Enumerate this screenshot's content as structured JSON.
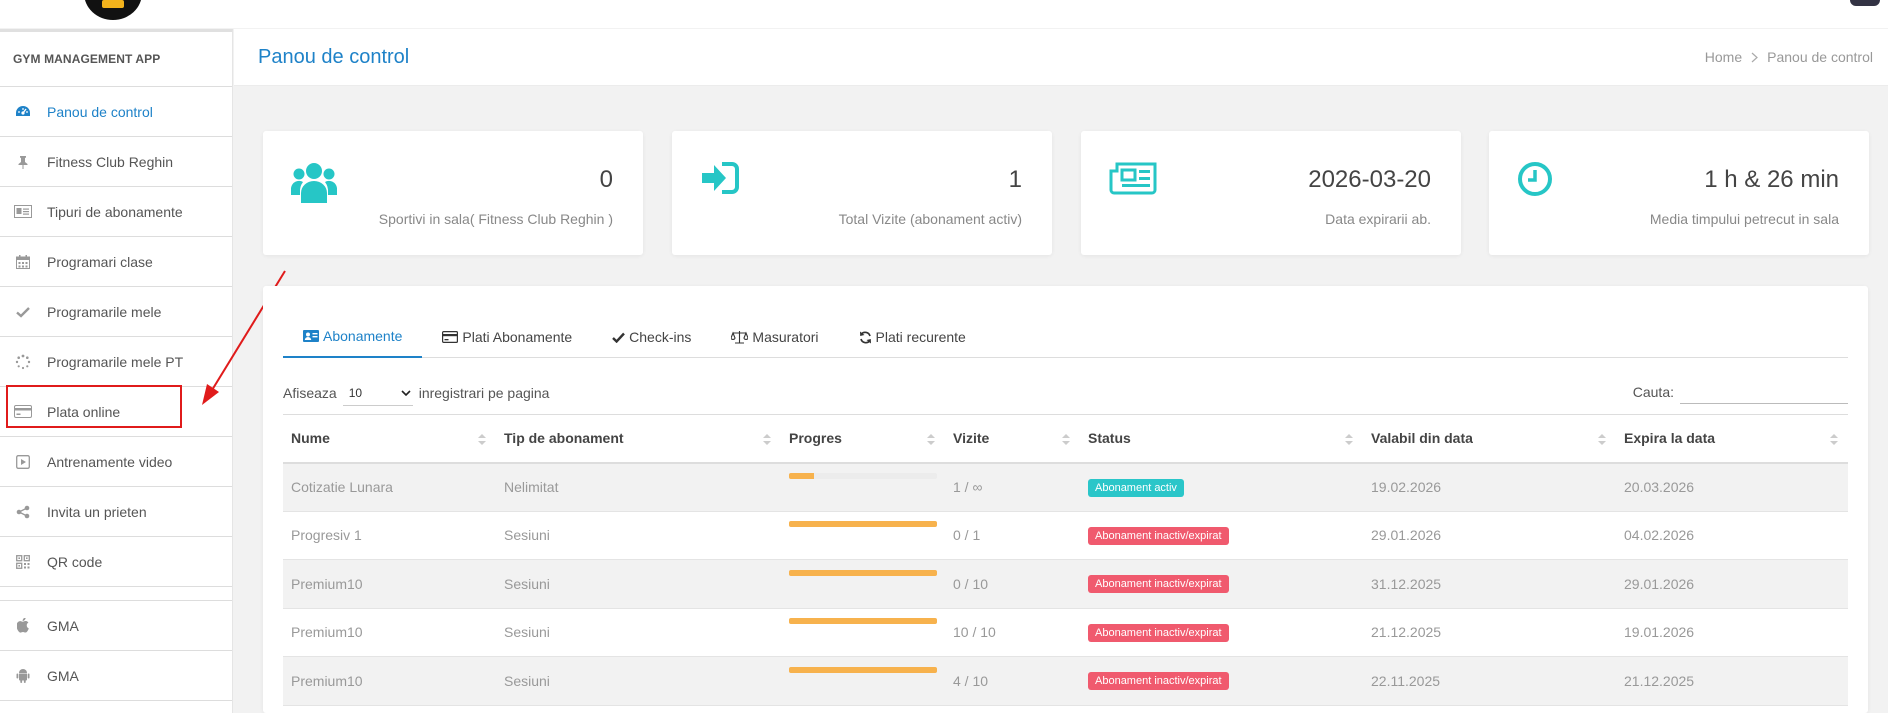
{
  "app": {
    "name": "GYM MANAGEMENT APP"
  },
  "sidebar": {
    "items": [
      {
        "label": "Panou de control",
        "icon": "dashboard-icon",
        "active": true
      },
      {
        "label": "Fitness Club Reghin",
        "icon": "pin-icon"
      },
      {
        "label": "Tipuri de abonamente",
        "icon": "card-icon"
      },
      {
        "label": "Programari clase",
        "icon": "calendar-icon"
      },
      {
        "label": "Programarile mele",
        "icon": "check-icon"
      },
      {
        "label": "Programarile mele PT",
        "icon": "spinner-icon"
      },
      {
        "label": "Plata online",
        "icon": "credit-card-icon"
      },
      {
        "label": "Antrenamente video",
        "icon": "play-icon"
      },
      {
        "label": "Invita un prieten",
        "icon": "share-icon"
      },
      {
        "label": "QR code",
        "icon": "qrcode-icon"
      }
    ],
    "apps": [
      {
        "label": "GMA",
        "icon": "apple-icon"
      },
      {
        "label": "GMA",
        "icon": "android-icon"
      }
    ]
  },
  "header": {
    "title": "Panou de control",
    "breadcrumb": [
      "Home",
      "Panou de control"
    ]
  },
  "stats": [
    {
      "value": "0",
      "label": "Sportivi in sala( Fitness Club Reghin )",
      "icon": "users-icon"
    },
    {
      "value": "1",
      "label": "Total Vizite (abonament activ)",
      "icon": "sign-in-icon"
    },
    {
      "value": "2026-03-20",
      "label": "Data expirarii ab.",
      "icon": "newspaper-icon"
    },
    {
      "value": "1 h & 26 min",
      "label": "Media timpului petrecut in sala",
      "icon": "clock-icon"
    }
  ],
  "tabs": [
    {
      "label": "Abonamente",
      "icon": "id-card-icon",
      "active": true
    },
    {
      "label": "Plati Abonamente",
      "icon": "credit-card-icon"
    },
    {
      "label": "Check-ins",
      "icon": "check-icon"
    },
    {
      "label": "Masuratori",
      "icon": "balance-scale-icon"
    },
    {
      "label": "Plati recurente",
      "icon": "refresh-icon"
    }
  ],
  "table_controls": {
    "show_label": "Afiseaza",
    "page_size": "10",
    "records_label": "inregistrari pe pagina",
    "search_label": "Cauta:",
    "search_value": ""
  },
  "table": {
    "columns": [
      "Nume",
      "Tip de abonament",
      "Progres",
      "Vizite",
      "Status",
      "Valabil din data",
      "Expira la data"
    ],
    "rows": [
      {
        "name": "Cotizatie Lunara",
        "type": "Nelimitat",
        "progress": 0.17,
        "visits": "1 / ∞",
        "status": "Abonament activ",
        "status_kind": "active",
        "from": "19.02.2026",
        "to": "20.03.2026"
      },
      {
        "name": "Progresiv 1",
        "type": "Sesiuni",
        "progress": 1.0,
        "visits": "0 / 1",
        "status": "Abonament inactiv/expirat",
        "status_kind": "expired",
        "from": "29.01.2026",
        "to": "04.02.2026"
      },
      {
        "name": "Premium10",
        "type": "Sesiuni",
        "progress": 1.0,
        "visits": "0 / 10",
        "status": "Abonament inactiv/expirat",
        "status_kind": "expired",
        "from": "31.12.2025",
        "to": "29.01.2026"
      },
      {
        "name": "Premium10",
        "type": "Sesiuni",
        "progress": 1.0,
        "visits": "10 / 10",
        "status": "Abonament inactiv/expirat",
        "status_kind": "expired",
        "from": "21.12.2025",
        "to": "19.01.2026"
      },
      {
        "name": "Premium10",
        "type": "Sesiuni",
        "progress": 1.0,
        "visits": "4 / 10",
        "status": "Abonament inactiv/expirat",
        "status_kind": "expired",
        "from": "22.11.2025",
        "to": "21.12.2025"
      }
    ]
  },
  "colors": {
    "accent": "#1e82c8",
    "stat_icon": "#26c6c6",
    "badge_active": "#2ac6c9",
    "badge_expired": "#f05a6e",
    "progress": "#f7b24d",
    "annotation": "#e01b1b"
  }
}
